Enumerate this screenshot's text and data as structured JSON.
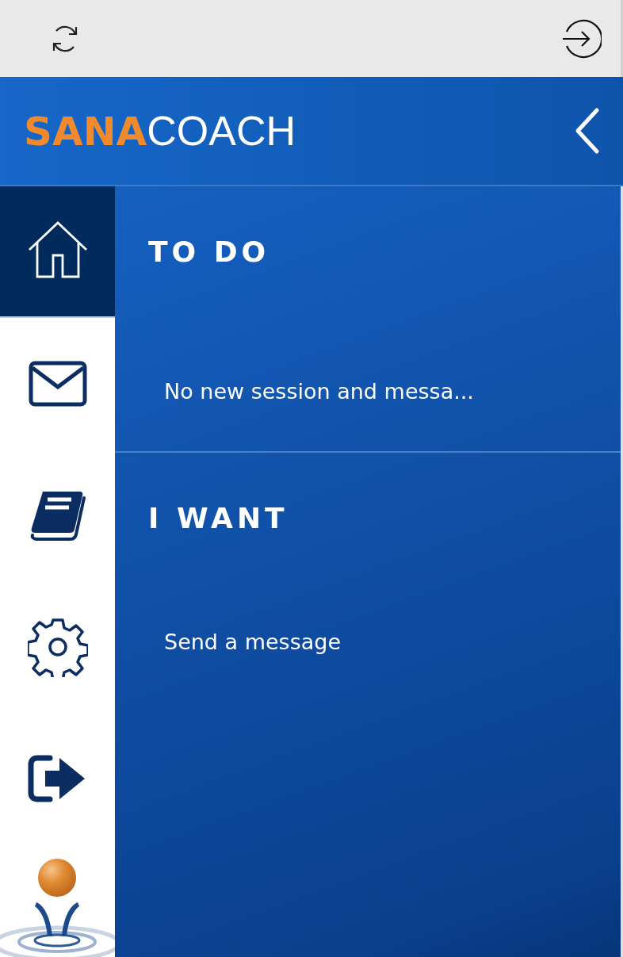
{
  "toolbar": {
    "buttons": [
      {
        "kind": "refresh"
      },
      {
        "kind": "sign-in"
      }
    ]
  },
  "header": {
    "logo": {
      "bold_part": "SANA",
      "light_part": "COACH"
    },
    "back_button": {
      "kind": "chevron-left"
    }
  },
  "sidebar": {
    "items": [
      {
        "kind": "home",
        "selected": true
      },
      {
        "kind": "mail",
        "selected": false
      },
      {
        "kind": "book",
        "selected": false
      },
      {
        "kind": "gear",
        "selected": false
      },
      {
        "kind": "exit",
        "selected": false
      }
    ]
  },
  "sections": [
    {
      "title": "TO DO",
      "items": [
        "No new session and messa..."
      ]
    },
    {
      "title": "I WANT",
      "items": [
        "Send a message"
      ]
    }
  ]
}
